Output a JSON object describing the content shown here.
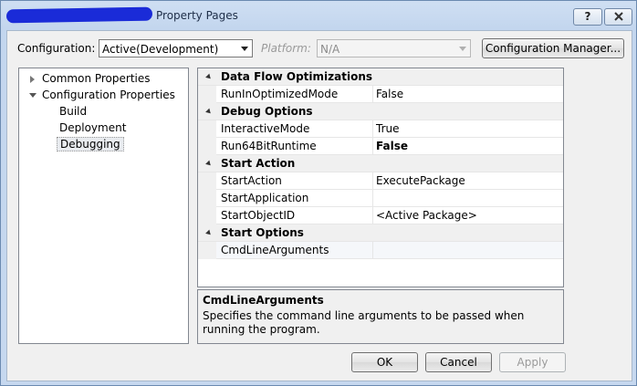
{
  "window": {
    "title": "Property Pages",
    "help_button": "?",
    "close_button": "X"
  },
  "toolbar": {
    "configuration_label": "Configuration:",
    "configuration_value": "Active(Development)",
    "platform_label": "Platform:",
    "platform_value": "N/A",
    "config_manager_label": "Configuration Manager..."
  },
  "tree": {
    "items": [
      {
        "label": "Common Properties",
        "expander": "collapsed"
      },
      {
        "label": "Configuration Properties",
        "expander": "expanded"
      },
      {
        "label": "Build"
      },
      {
        "label": "Deployment"
      },
      {
        "label": "Debugging",
        "selected": true
      }
    ]
  },
  "grid": {
    "rows": [
      {
        "category": "Data Flow Optimizations"
      },
      {
        "name": "RunInOptimizedMode",
        "value": "False"
      },
      {
        "category": "Debug Options"
      },
      {
        "name": "InteractiveMode",
        "value": "True"
      },
      {
        "name": "Run64BitRuntime",
        "value": "False",
        "bold": true
      },
      {
        "category": "Start Action"
      },
      {
        "name": "StartAction",
        "value": "ExecutePackage"
      },
      {
        "name": "StartApplication",
        "value": ""
      },
      {
        "name": "StartObjectID",
        "value": "<Active Package>"
      },
      {
        "category": "Start Options"
      },
      {
        "name": "CmdLineArguments",
        "value": ""
      }
    ]
  },
  "description": {
    "title": "CmdLineArguments",
    "text": "Specifies the command line arguments to be passed when running the program."
  },
  "buttons": {
    "ok": "OK",
    "cancel": "Cancel",
    "apply": "Apply"
  },
  "colors": {
    "title_scribble": "#1a2bd8",
    "window_frame": "#c6d8ef"
  }
}
